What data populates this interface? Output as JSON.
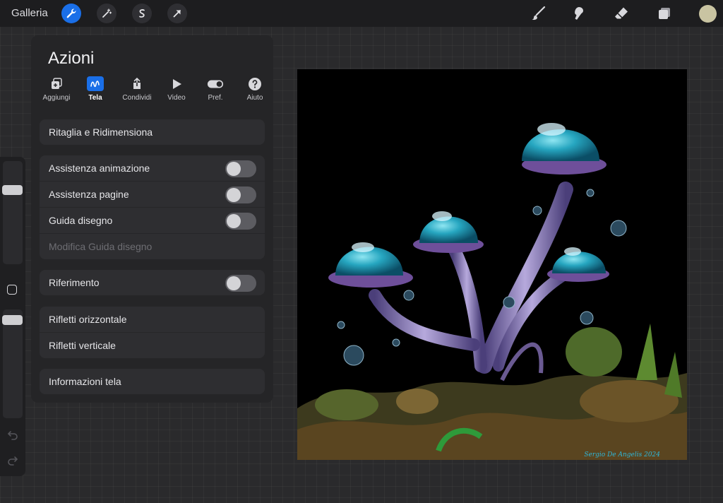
{
  "topbar": {
    "gallery_label": "Galleria",
    "left_icons": [
      "wrench-icon",
      "magic-wand-icon",
      "selection-s-icon",
      "transform-arrow-icon"
    ],
    "right_icons": [
      "brush-icon",
      "smudge-icon",
      "eraser-icon",
      "layers-icon"
    ],
    "color": "#c9c4a2",
    "accent": "#1a6fe8"
  },
  "panel": {
    "title": "Azioni",
    "tabs": [
      {
        "label": "Aggiungi",
        "icon": "add-image-icon"
      },
      {
        "label": "Tela",
        "icon": "canvas-wave-icon",
        "active": true
      },
      {
        "label": "Condividi",
        "icon": "share-icon"
      },
      {
        "label": "Video",
        "icon": "play-icon"
      },
      {
        "label": "Pref.",
        "icon": "toggle-icon"
      },
      {
        "label": "Aiuto",
        "icon": "help-icon"
      }
    ],
    "crop": "Ritaglia e Ridimensiona",
    "animation_assist": "Assistenza animazione",
    "page_assist": "Assistenza pagine",
    "drawing_guide": "Guida disegno",
    "edit_drawing_guide": "Modifica Guida disegno",
    "reference": "Riferimento",
    "flip_horizontal": "Rifletti orizzontale",
    "flip_vertical": "Rifletti verticale",
    "canvas_info": "Informazioni tela"
  },
  "canvas": {
    "signature": "Sergio De Angelis 2024"
  }
}
